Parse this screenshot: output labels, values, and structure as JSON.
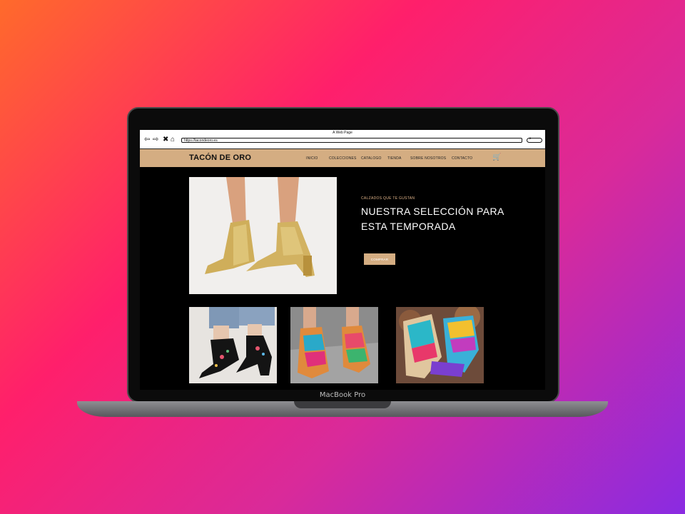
{
  "device": {
    "label": "MacBook Pro"
  },
  "browser": {
    "title": "A Web Page",
    "url": "https://tacondeoro.es",
    "icons": [
      "back-arrow-icon",
      "forward-arrow-icon",
      "close-icon",
      "home-icon",
      "search-icon"
    ]
  },
  "site": {
    "brand": "TACÓN DE ORO",
    "nav": [
      "INICIO",
      "COLECCIONES",
      "CATALOGO",
      "TIENDA",
      "SOBRE NOSOTROS",
      "CONTACTO"
    ],
    "cart_icon": "cart-icon",
    "accent_color": "#d4ad82"
  },
  "hero": {
    "kicker": "CALZADOS QUE TE GUSTAN",
    "title": "NUESTRA SELECCIÓN PARA ESTA TEMPORADA",
    "button": "COMPRAR"
  },
  "gallery": [
    "embroidered-heels-image",
    "colorful-sandals-image",
    "woven-sandals-image"
  ]
}
